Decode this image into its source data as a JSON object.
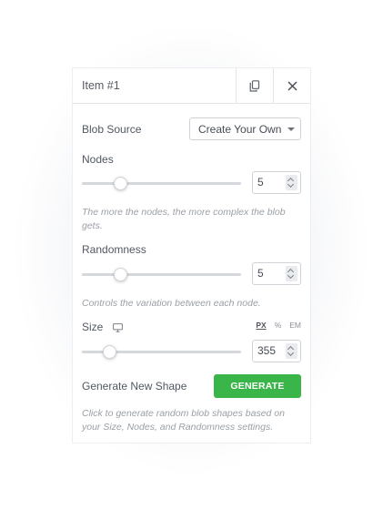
{
  "header": {
    "title": "Item #1",
    "duplicate_icon": "copy-icon",
    "close_icon": "close-icon"
  },
  "blob_source": {
    "label": "Blob Source",
    "value": "Create Your Own"
  },
  "nodes": {
    "label": "Nodes",
    "value": "5",
    "slider_level": 0.24,
    "help": "The more the nodes, the more complex the blob gets."
  },
  "randomness": {
    "label": "Randomness",
    "value": "5",
    "slider_level": 0.24,
    "help": "Controls the variation between each node."
  },
  "size": {
    "label": "Size",
    "device_icon": "desktop-icon",
    "units": [
      "PX",
      "%",
      "EM"
    ],
    "active_unit": "PX",
    "value": "355",
    "slider_level": 0.18
  },
  "generate": {
    "label": "Generate New Shape",
    "button_label": "GENERATE",
    "help": "Click to generate random blob shapes based on your Size, Nodes, and Randomness settings."
  },
  "colors": {
    "accent_green": "#39b54a",
    "text": "#515862",
    "muted": "#9aa0a7"
  }
}
